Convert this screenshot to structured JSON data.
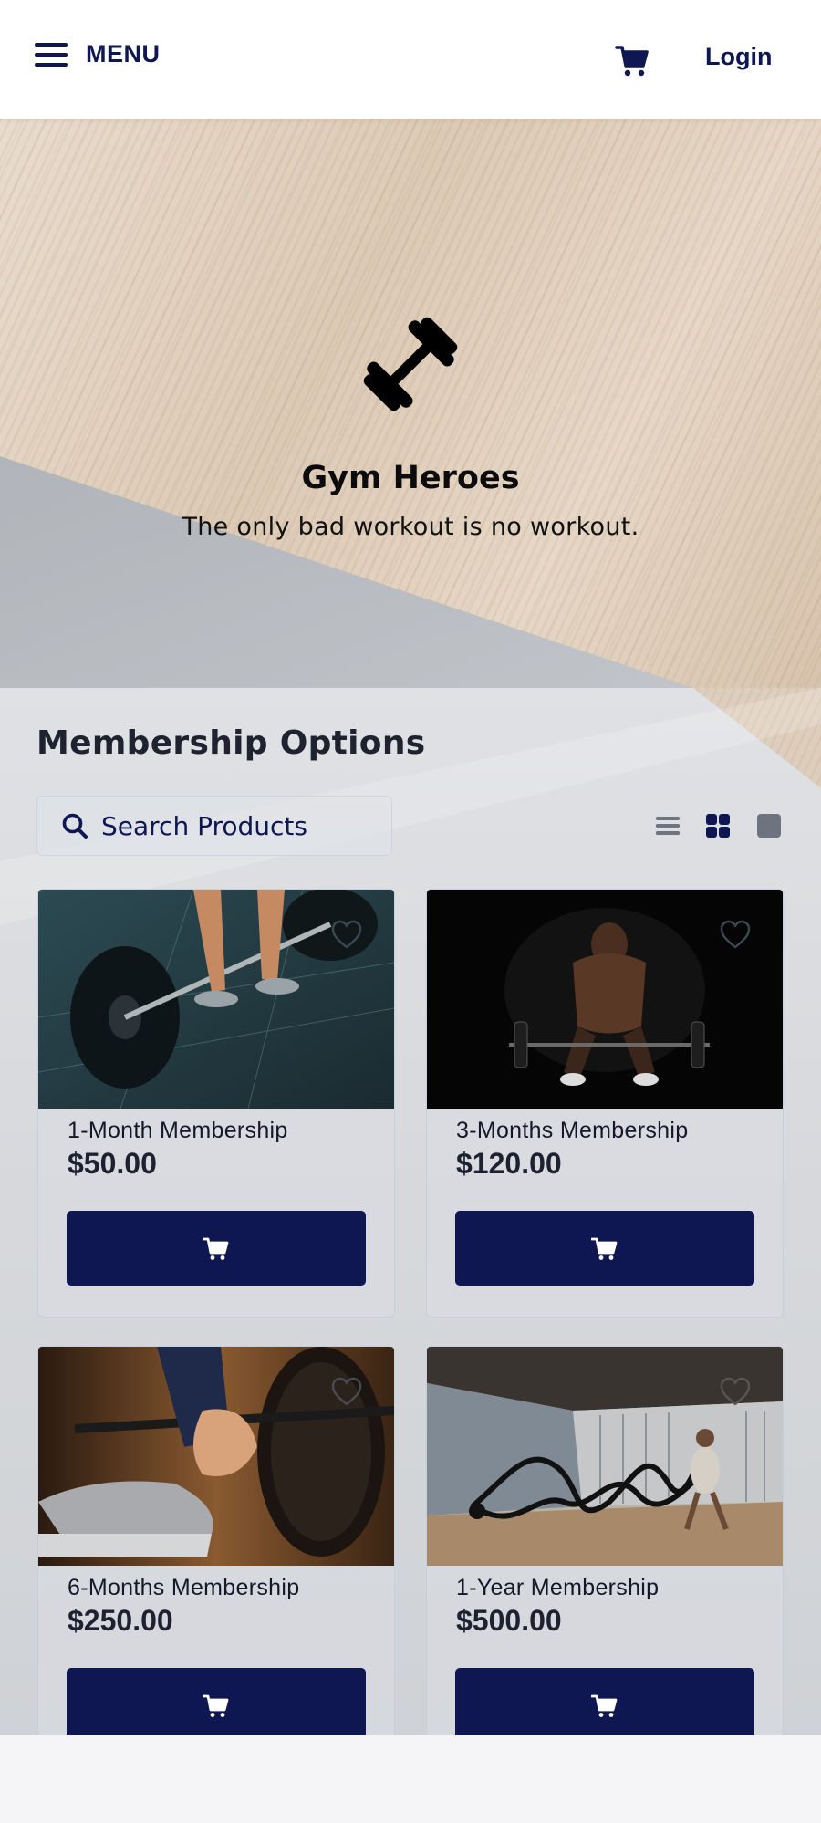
{
  "header": {
    "menu_label": "MENU",
    "login_label": "Login",
    "cart_icon": "cart-icon",
    "menu_icon": "hamburger-icon"
  },
  "hero": {
    "logo_icon": "dumbbell-icon",
    "title": "Gym Heroes",
    "tagline": "The only bad workout is no workout."
  },
  "main": {
    "section_title": "Membership Options",
    "search": {
      "placeholder": "Search Products",
      "value": ""
    },
    "view_modes": [
      "list-view-icon",
      "grid-view-icon",
      "single-view-icon"
    ],
    "active_view": "grid-view-icon",
    "products": [
      {
        "name": "1-Month Membership",
        "price": "$50.00",
        "image": "barbell-deadlift-photo"
      },
      {
        "name": "3-Months Membership",
        "price": "$120.00",
        "image": "dark-gym-athlete-photo"
      },
      {
        "name": "6-Months Membership",
        "price": "$250.00",
        "image": "hands-on-barbell-photo"
      },
      {
        "name": "1-Year Membership",
        "price": "$500.00",
        "image": "battle-ropes-photo"
      }
    ]
  },
  "colors": {
    "brand_navy": "#0f1752",
    "hero_wood": "#e4d5c4",
    "hero_gray": "#b2b6bb",
    "content_bg": "#d9dbde"
  }
}
